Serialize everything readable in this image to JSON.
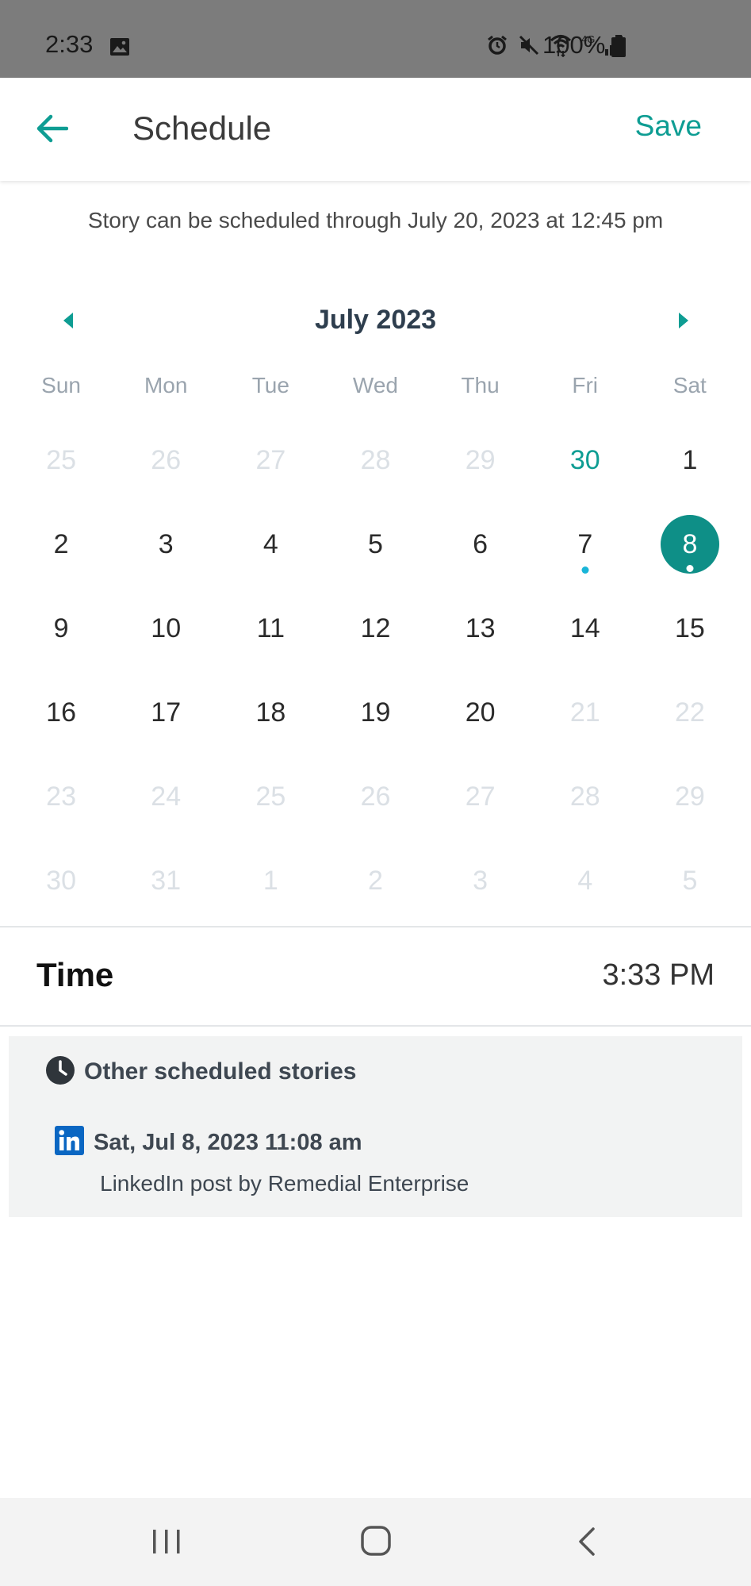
{
  "status_bar": {
    "time": "2:33",
    "battery_percent": "100%",
    "network_label": "4G",
    "icons": [
      "gallery-icon",
      "alarm-icon",
      "mute-icon",
      "wifi-icon",
      "signal-icon",
      "battery-icon"
    ]
  },
  "header": {
    "title": "Schedule",
    "save_label": "Save",
    "back_icon": "back-arrow-icon"
  },
  "notice": "Story can be scheduled through July 20, 2023 at 12:45 pm",
  "calendar": {
    "month_label": "July 2023",
    "weekdays": [
      "Sun",
      "Mon",
      "Tue",
      "Wed",
      "Thu",
      "Fri",
      "Sat"
    ],
    "days": [
      {
        "label": "25",
        "state": "muted"
      },
      {
        "label": "26",
        "state": "muted"
      },
      {
        "label": "27",
        "state": "muted"
      },
      {
        "label": "28",
        "state": "muted"
      },
      {
        "label": "29",
        "state": "muted"
      },
      {
        "label": "30",
        "state": "accent"
      },
      {
        "label": "1",
        "state": "normal"
      },
      {
        "label": "2",
        "state": "normal"
      },
      {
        "label": "3",
        "state": "normal"
      },
      {
        "label": "4",
        "state": "normal"
      },
      {
        "label": "5",
        "state": "normal"
      },
      {
        "label": "6",
        "state": "normal"
      },
      {
        "label": "7",
        "state": "normal",
        "dot": true
      },
      {
        "label": "8",
        "state": "selected",
        "dot": true
      },
      {
        "label": "9",
        "state": "normal"
      },
      {
        "label": "10",
        "state": "normal"
      },
      {
        "label": "11",
        "state": "normal"
      },
      {
        "label": "12",
        "state": "normal"
      },
      {
        "label": "13",
        "state": "normal"
      },
      {
        "label": "14",
        "state": "normal"
      },
      {
        "label": "15",
        "state": "normal"
      },
      {
        "label": "16",
        "state": "normal"
      },
      {
        "label": "17",
        "state": "normal"
      },
      {
        "label": "18",
        "state": "normal"
      },
      {
        "label": "19",
        "state": "normal"
      },
      {
        "label": "20",
        "state": "normal"
      },
      {
        "label": "21",
        "state": "muted"
      },
      {
        "label": "22",
        "state": "muted"
      },
      {
        "label": "23",
        "state": "muted"
      },
      {
        "label": "24",
        "state": "muted"
      },
      {
        "label": "25",
        "state": "muted"
      },
      {
        "label": "26",
        "state": "muted"
      },
      {
        "label": "27",
        "state": "muted"
      },
      {
        "label": "28",
        "state": "muted"
      },
      {
        "label": "29",
        "state": "muted"
      },
      {
        "label": "30",
        "state": "muted"
      },
      {
        "label": "31",
        "state": "muted"
      },
      {
        "label": "1",
        "state": "muted"
      },
      {
        "label": "2",
        "state": "muted"
      },
      {
        "label": "3",
        "state": "muted"
      },
      {
        "label": "4",
        "state": "muted"
      },
      {
        "label": "5",
        "state": "muted"
      }
    ]
  },
  "time_row": {
    "label": "Time",
    "value": "3:33 PM"
  },
  "scheduled_stories": {
    "title": "Other scheduled stories",
    "items": [
      {
        "network_icon": "linkedin-icon",
        "date": "Sat, Jul 8, 2023 11:08 am",
        "description": "LinkedIn post by Remedial Enterprise"
      }
    ]
  },
  "colors": {
    "accent": "#0e9d93",
    "selected_day_bg": "#0e8f87",
    "event_dot": "#19b5d8",
    "muted_day": "#dbe0e5",
    "status_bar_bg": "#7c7c7c",
    "panel_bg": "#f2f3f3",
    "linkedin_blue": "#0a66c2"
  }
}
